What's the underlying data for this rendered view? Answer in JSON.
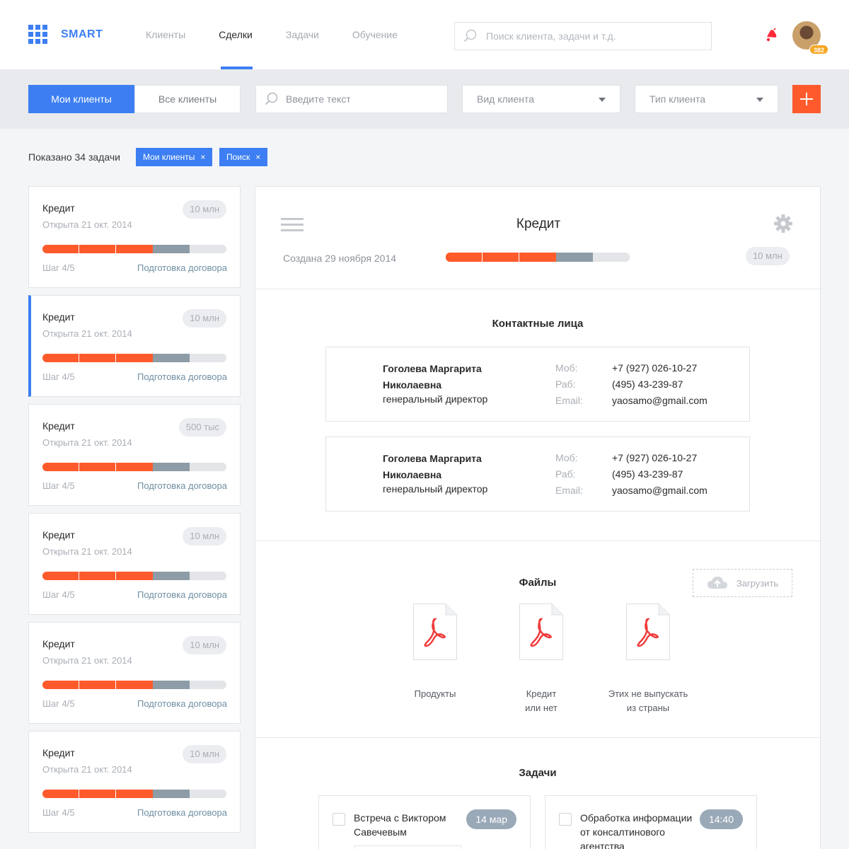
{
  "header": {
    "logo_text": "SMART",
    "nav": [
      {
        "label": "Клиенты",
        "active": false
      },
      {
        "label": "Сделки",
        "active": true
      },
      {
        "label": "Задачи",
        "active": false
      },
      {
        "label": "Обучение",
        "active": false
      }
    ],
    "search_placeholder": "Поиск клиента, задачи и т.д.",
    "avatar_badge": "382"
  },
  "toolbar": {
    "segment": [
      "Мои клиенты",
      "Все клиенты"
    ],
    "search_placeholder": "Введите текст",
    "client_kind": "Вид клиента",
    "client_type": "Тип клиента"
  },
  "filters": {
    "shown_text": "Показано 34 задачи",
    "chips": [
      "Мои клиенты",
      "Поиск"
    ],
    "chip_close": "×"
  },
  "colors": {
    "accent": "#3d7ff2",
    "progress_done": "#ff5a2b",
    "progress_current": "#8d9ca6",
    "progress_rest": "#e3e5e8",
    "add_button": "#ff5a2b"
  },
  "deals": [
    {
      "title": "Кредит",
      "date": "Открыта 21 окт. 2014",
      "amount": "10 млн",
      "step": "Шаг 4/5",
      "stage": "Подготовка договора",
      "progress_done_segments": 3,
      "progress_current_segments": 1,
      "progress_total_segments": 5,
      "selected": false
    },
    {
      "title": "Кредит",
      "date": "Открыта 21 окт. 2014",
      "amount": "10 млн",
      "step": "Шаг 4/5",
      "stage": "Подготовка договора",
      "progress_done_segments": 3,
      "progress_current_segments": 1,
      "progress_total_segments": 5,
      "selected": true
    },
    {
      "title": "Кредит",
      "date": "Открыта 21 окт. 2014",
      "amount": "500 тыс",
      "step": "Шаг 4/5",
      "stage": "Подготовка договора",
      "progress_done_segments": 3,
      "progress_current_segments": 1,
      "progress_total_segments": 5,
      "selected": false
    },
    {
      "title": "Кредит",
      "date": "Открыта 21 окт. 2014",
      "amount": "10 млн",
      "step": "Шаг 4/5",
      "stage": "Подготовка договора",
      "progress_done_segments": 3,
      "progress_current_segments": 1,
      "progress_total_segments": 5,
      "selected": false
    },
    {
      "title": "Кредит",
      "date": "Открыта 21 окт. 2014",
      "amount": "10 млн",
      "step": "Шаг 4/5",
      "stage": "Подготовка договора",
      "progress_done_segments": 3,
      "progress_current_segments": 1,
      "progress_total_segments": 5,
      "selected": false
    },
    {
      "title": "Кредит",
      "date": "Открыта 21 окт. 2014",
      "amount": "10 млн",
      "step": "Шаг 4/5",
      "stage": "Подготовка договора",
      "progress_done_segments": 3,
      "progress_current_segments": 1,
      "progress_total_segments": 5,
      "selected": false
    }
  ],
  "detail": {
    "title": "Кредит",
    "created": "Создана 29 ноября 2014",
    "amount": "10 млн",
    "progress_done_segments": 3,
    "progress_current_segments": 1,
    "progress_total_segments": 5,
    "contacts_title": "Контактные лица",
    "contacts": [
      {
        "name": "Гоголева Маргарита Николаевна",
        "role": "генеральный директор",
        "mobile_label": "Моб:",
        "mobile": "+7 (927) 026-10-27",
        "work_label": "Раб:",
        "work": "(495) 43-239-87",
        "email_label": "Email:",
        "email": "yaosamo@gmail.com"
      },
      {
        "name": "Гоголева Маргарита Николаевна",
        "role": "генеральный директор",
        "mobile_label": "Моб:",
        "mobile": "+7 (927) 026-10-27",
        "work_label": "Раб:",
        "work": "(495) 43-239-87",
        "email_label": "Email:",
        "email": "yaosamo@gmail.com"
      }
    ],
    "files_title": "Файлы",
    "upload_label": "Загрузить",
    "files": [
      {
        "name_line1": "Продукты",
        "name_line2": ""
      },
      {
        "name_line1": "Кредит",
        "name_line2": "или нет"
      },
      {
        "name_line1": "Этих не выпускать",
        "name_line2": "из страны"
      }
    ],
    "tasks_title": "Задачи",
    "tasks": [
      {
        "text": "Встреча с Виктором Савечевым",
        "badge": "14 мар"
      },
      {
        "text": "Обработка информации от консалтинового агентства",
        "badge": "14:40"
      }
    ]
  }
}
